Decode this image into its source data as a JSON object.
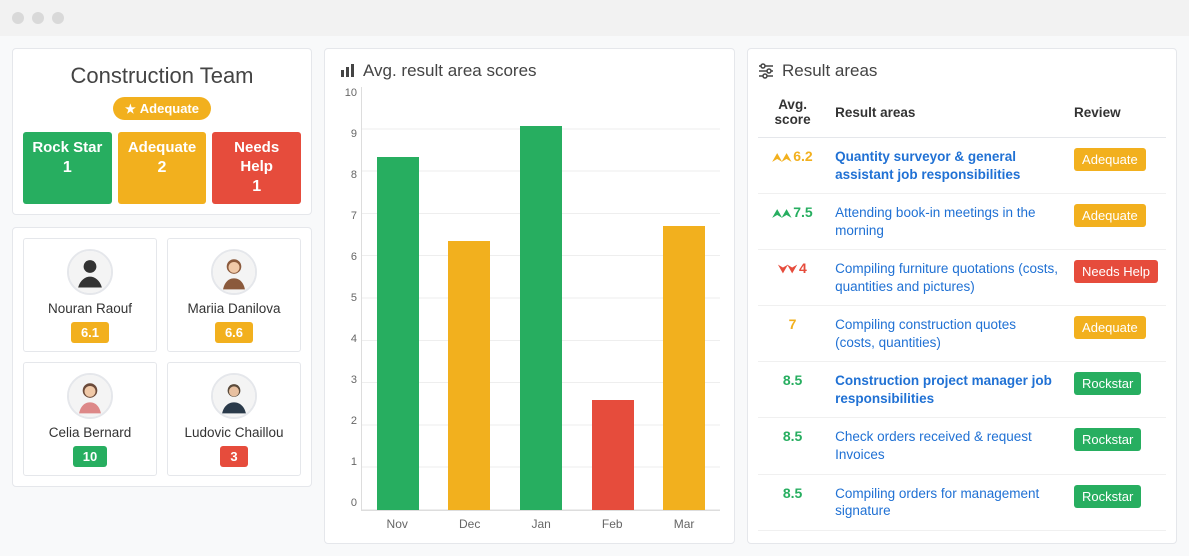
{
  "team": {
    "title": "Construction Team",
    "badge_label": "Adequate",
    "statuses": [
      {
        "label": "Rock Star",
        "count": "1",
        "color": "green"
      },
      {
        "label": "Adequate",
        "count": "2",
        "color": "yellow"
      },
      {
        "label": "Needs Help",
        "count": "1",
        "color": "red"
      }
    ]
  },
  "members": [
    {
      "name": "Nouran Raouf",
      "score": "6.1",
      "color": "yellow"
    },
    {
      "name": "Mariia Danilova",
      "score": "6.6",
      "color": "yellow"
    },
    {
      "name": "Celia Bernard",
      "score": "10",
      "color": "green"
    },
    {
      "name": "Ludovic Chaillou",
      "score": "3",
      "color": "red"
    }
  ],
  "chart_panel_title": "Avg. result area scores",
  "chart_data": {
    "type": "bar",
    "categories": [
      "Nov",
      "Dec",
      "Jan",
      "Feb",
      "Mar"
    ],
    "values": [
      8.35,
      6.35,
      9.07,
      2.6,
      6.7
    ],
    "colors": [
      "#27ae60",
      "#f2b01e",
      "#27ae60",
      "#e64c3c",
      "#f2b01e"
    ],
    "ylim": [
      0,
      10
    ],
    "yticks": [
      "0",
      "1",
      "2",
      "3",
      "4",
      "5",
      "6",
      "7",
      "8",
      "9",
      "10"
    ]
  },
  "result_panel_title": "Result areas",
  "result_headers": {
    "avg": "Avg. score",
    "areas": "Result areas",
    "review": "Review"
  },
  "result_rows": [
    {
      "score": "6.2",
      "score_color": "avg-yellow",
      "trend": "up",
      "area": "Quantity surveyor & general assistant job responsibilities",
      "bold": true,
      "review": "Adequate",
      "review_color": "yellow"
    },
    {
      "score": "7.5",
      "score_color": "avg-green",
      "trend": "up",
      "area": "Attending book-in meetings in the morning",
      "bold": false,
      "review": "Adequate",
      "review_color": "yellow"
    },
    {
      "score": "4",
      "score_color": "avg-red",
      "trend": "down",
      "area": "Compiling furniture quotations (costs, quantities and pictures)",
      "bold": false,
      "review": "Needs Help",
      "review_color": "red"
    },
    {
      "score": "7",
      "score_color": "avg-yellow",
      "trend": "",
      "area": "Compiling construction quotes (costs, quantities)",
      "bold": false,
      "review": "Adequate",
      "review_color": "yellow"
    },
    {
      "score": "8.5",
      "score_color": "avg-green",
      "trend": "",
      "area": "Construction project manager job responsibilities",
      "bold": true,
      "review": "Rockstar",
      "review_color": "green"
    },
    {
      "score": "8.5",
      "score_color": "avg-green",
      "trend": "",
      "area": "Check orders received & request Invoices",
      "bold": false,
      "review": "Rockstar",
      "review_color": "green"
    },
    {
      "score": "8.5",
      "score_color": "avg-green",
      "trend": "",
      "area": "Compiling orders for management signature",
      "bold": false,
      "review": "Rockstar",
      "review_color": "green"
    }
  ]
}
